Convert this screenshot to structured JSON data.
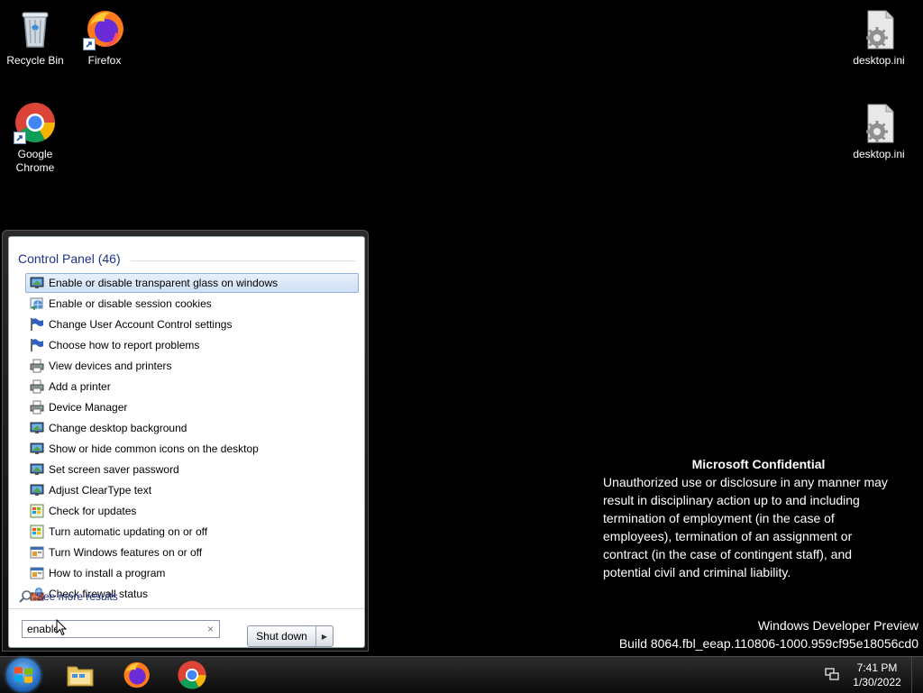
{
  "desktop": {
    "icons": [
      {
        "label": "Recycle Bin"
      },
      {
        "label": "Firefox"
      },
      {
        "label": "Google Chrome"
      },
      {
        "label": "desktop.ini"
      },
      {
        "label": "desktop.ini"
      }
    ]
  },
  "start_menu": {
    "section_header": "Control Panel (46)",
    "results": [
      {
        "label": "Enable or disable transparent glass on windows",
        "icon": "display-settings-icon"
      },
      {
        "label": "Enable or disable session cookies",
        "icon": "internet-options-icon"
      },
      {
        "label": "Change User Account Control settings",
        "icon": "action-center-flag-icon"
      },
      {
        "label": "Choose how to report problems",
        "icon": "action-center-flag-icon"
      },
      {
        "label": "View devices and printers",
        "icon": "printer-icon"
      },
      {
        "label": "Add a printer",
        "icon": "printer-icon"
      },
      {
        "label": "Device Manager",
        "icon": "printer-icon"
      },
      {
        "label": "Change desktop background",
        "icon": "display-settings-icon"
      },
      {
        "label": "Show or hide common icons on the desktop",
        "icon": "display-settings-icon"
      },
      {
        "label": "Set screen saver password",
        "icon": "display-settings-icon"
      },
      {
        "label": "Adjust ClearType text",
        "icon": "display-settings-icon"
      },
      {
        "label": "Check for updates",
        "icon": "windows-update-icon"
      },
      {
        "label": "Turn automatic updating on or off",
        "icon": "windows-update-icon"
      },
      {
        "label": "Turn Windows features on or off",
        "icon": "programs-icon"
      },
      {
        "label": "How to install a program",
        "icon": "programs-icon"
      },
      {
        "label": "Check firewall status",
        "icon": "firewall-icon"
      }
    ],
    "see_more": "See more results",
    "search_value": "enable",
    "search_clear": "×",
    "shutdown_label": "Shut down"
  },
  "watermark": {
    "title": "Microsoft Confidential",
    "lines": [
      "Unauthorized use or disclosure in any manner may",
      "result in disciplinary action up to and including",
      "termination of employment (in the case of",
      "employees), termination of an assignment or",
      "contract (in the case of contingent staff), and",
      "potential civil and criminal liability."
    ],
    "build_line1": "Windows Developer Preview",
    "build_line2": "Build 8064.fbl_eeap.110806-1000.959cf95e18056cd0"
  },
  "taskbar": {
    "clock_time": "7:41 PM",
    "clock_date": "1/30/2022"
  },
  "colors": {
    "desktop_background": "#000000",
    "link_blue": "#1e3287",
    "selection_border": "#8fb2df"
  }
}
